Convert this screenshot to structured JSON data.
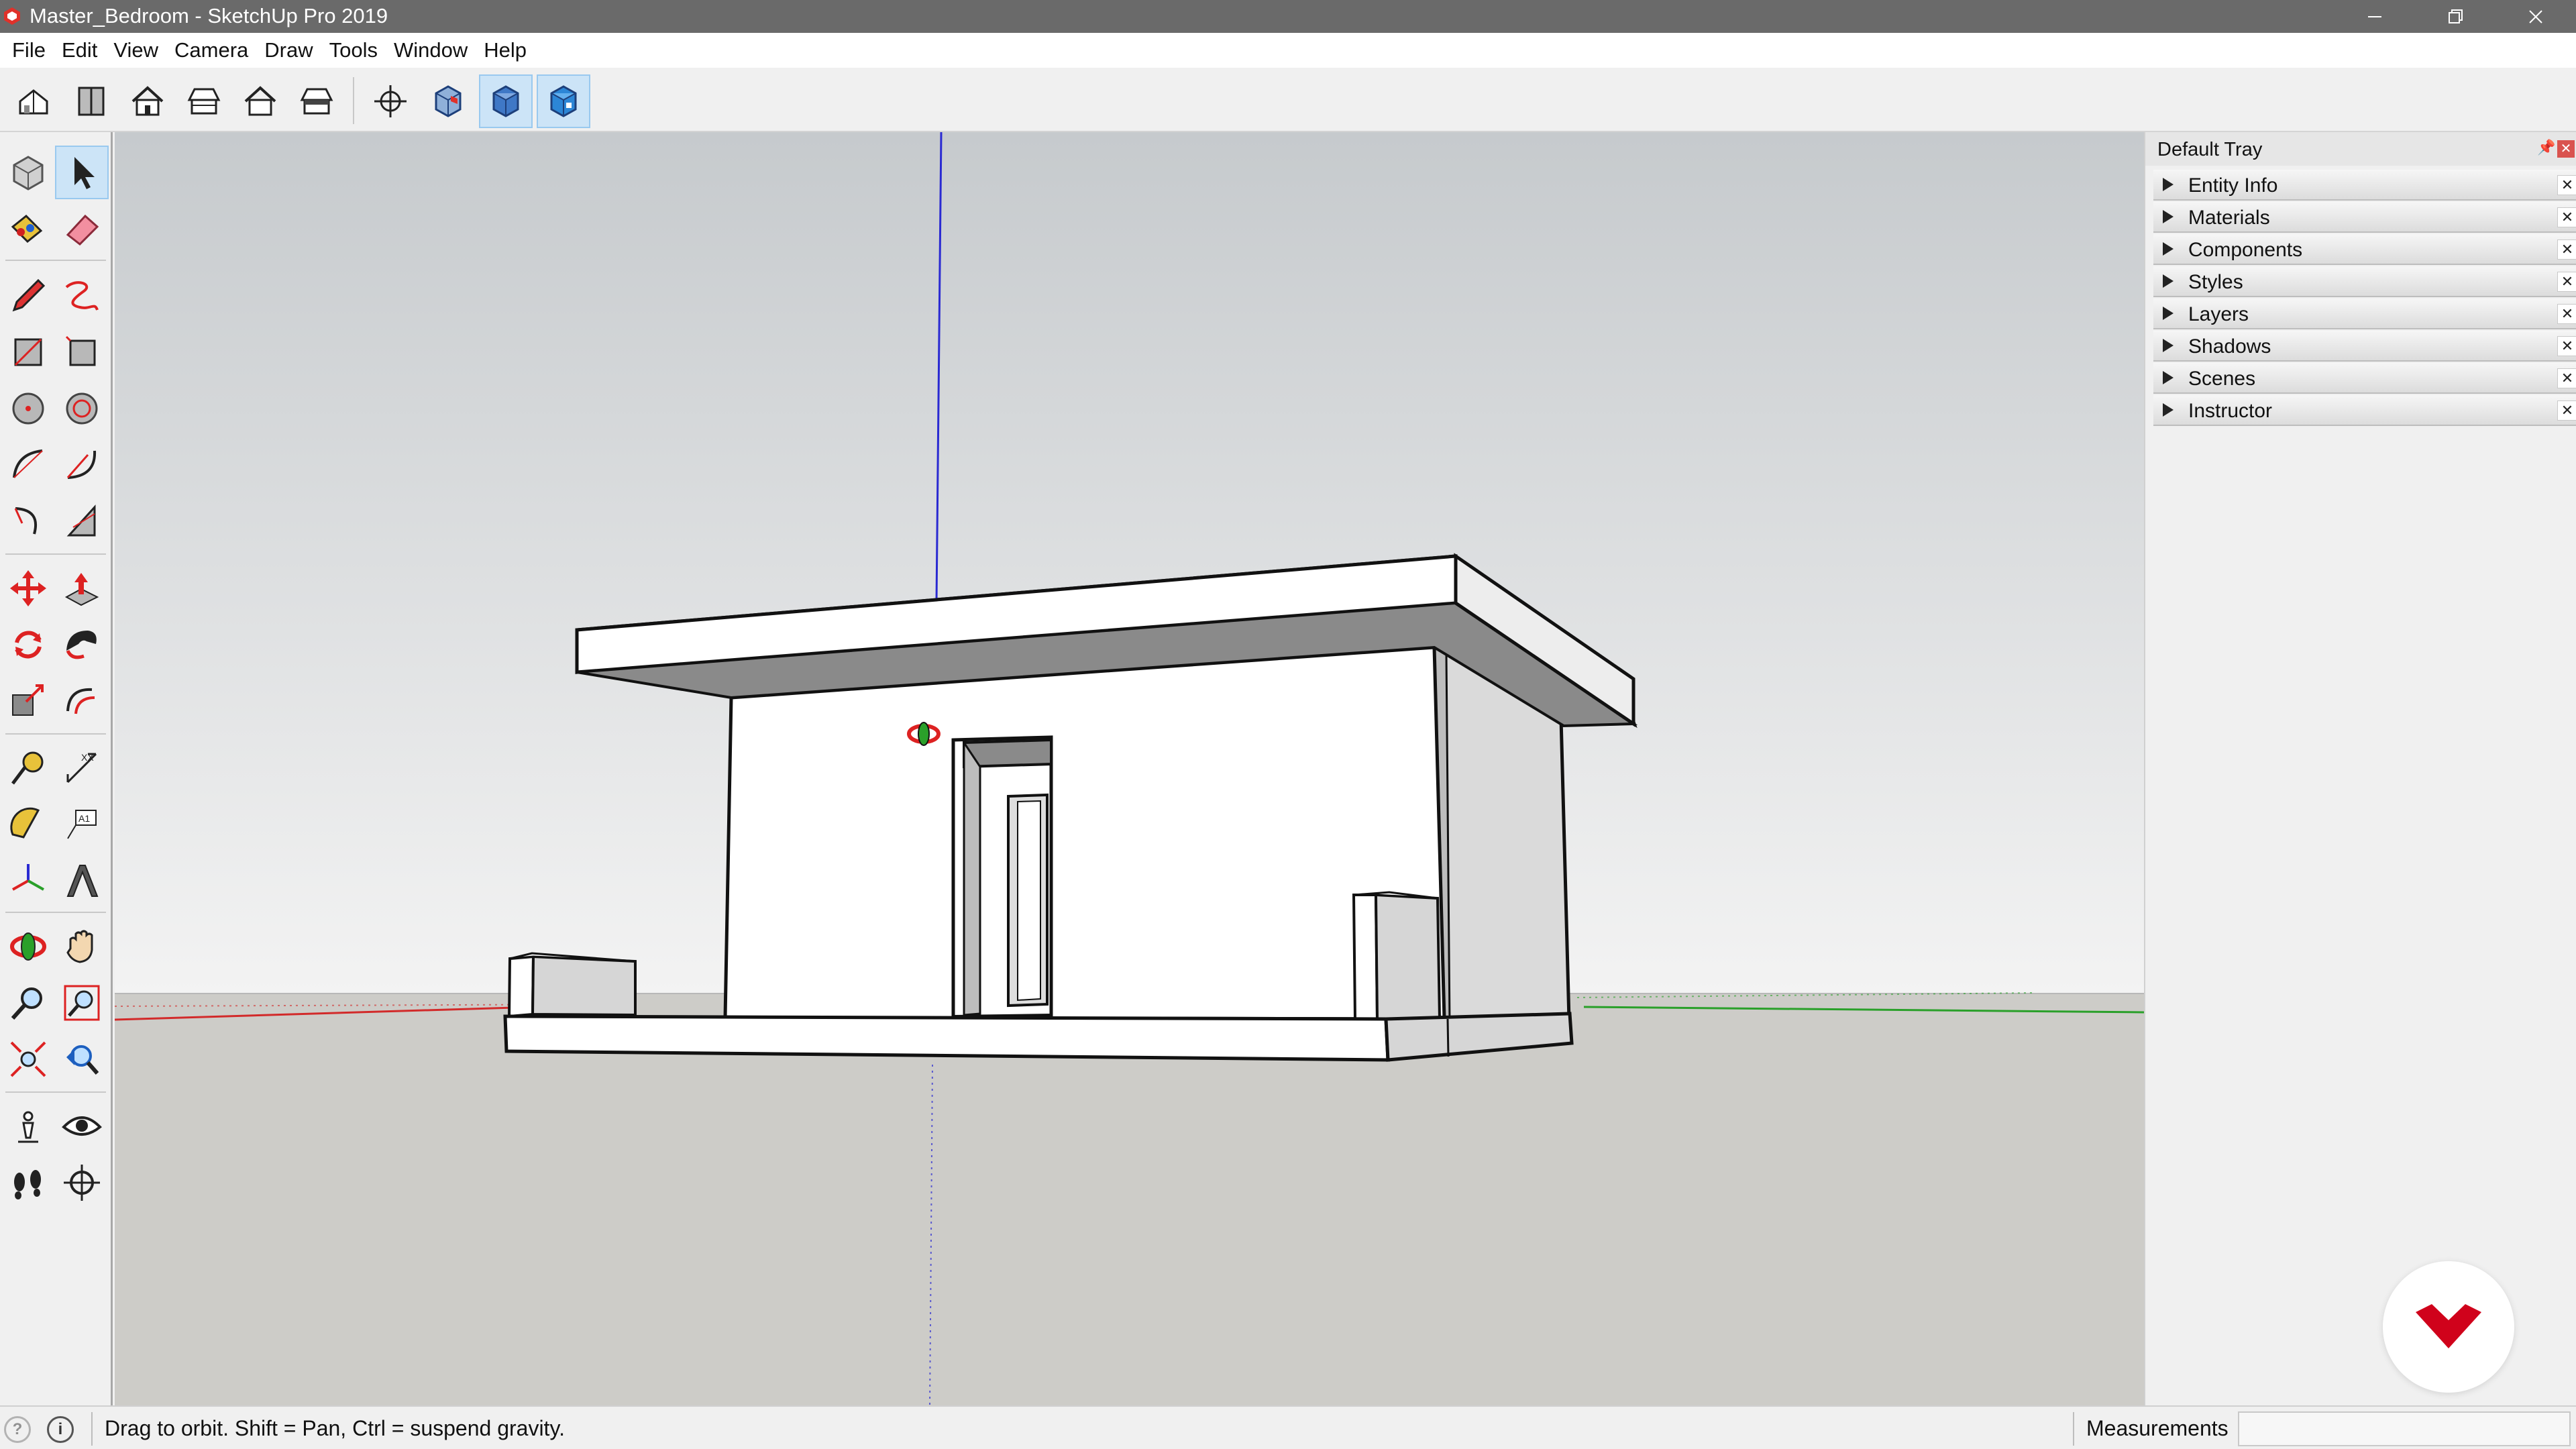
{
  "window": {
    "title": "Master_Bedroom - SketchUp Pro 2019",
    "app_icon": "sketchup-logo-icon",
    "controls": [
      "minimize-icon",
      "restore-icon",
      "close-icon"
    ]
  },
  "menu": [
    "File",
    "Edit",
    "View",
    "Camera",
    "Draw",
    "Tools",
    "Window",
    "Help"
  ],
  "toolbar": {
    "view_buttons": [
      {
        "name": "iso-view-button",
        "icon": "iso-house-icon"
      },
      {
        "name": "top-view-button",
        "icon": "top-view-icon"
      },
      {
        "name": "front-view-button",
        "icon": "front-house-icon"
      },
      {
        "name": "right-view-button",
        "icon": "right-house-icon"
      },
      {
        "name": "back-view-button",
        "icon": "back-house-icon"
      },
      {
        "name": "left-view-button",
        "icon": "left-house-icon"
      }
    ],
    "style_buttons": [
      {
        "name": "xray-button",
        "icon": "xray-icon",
        "active": false
      },
      {
        "name": "wireframe-button",
        "icon": "wireframe-box-icon",
        "active": false
      },
      {
        "name": "shaded-button",
        "icon": "shaded-box-icon",
        "active": true
      },
      {
        "name": "shaded-textures-button",
        "icon": "shaded-textures-box-icon",
        "active": true
      }
    ]
  },
  "palette_tools": [
    [
      "make-component",
      "select"
    ],
    [
      "paint-bucket",
      "eraser"
    ],
    [
      "line",
      "freehand"
    ],
    [
      "rectangle",
      "rotated-rectangle"
    ],
    [
      "circle",
      "polygon"
    ],
    [
      "arc",
      "2-point-arc"
    ],
    [
      "3-point-arc",
      "pie"
    ],
    [
      "move",
      "push-pull"
    ],
    [
      "rotate",
      "follow-me"
    ],
    [
      "scale",
      "offset"
    ],
    [
      "tape-measure",
      "dimension"
    ],
    [
      "protractor",
      "text"
    ],
    [
      "axes",
      "3d-text"
    ],
    [
      "orbit",
      "pan"
    ],
    [
      "zoom",
      "zoom-window"
    ],
    [
      "zoom-extents",
      "previous-view"
    ],
    [
      "position-camera",
      "look-around"
    ],
    [
      "walk",
      "section-plane"
    ]
  ],
  "palette_active": "select",
  "tray": {
    "title": "Default Tray",
    "panels": [
      "Entity Info",
      "Materials",
      "Components",
      "Styles",
      "Layers",
      "Shadows",
      "Scenes",
      "Instructor"
    ]
  },
  "status": {
    "hint": "Drag to orbit. Shift = Pan, Ctrl = suspend gravity.",
    "measurements_label": "Measurements",
    "measurements_value": ""
  },
  "colors": {
    "titlebar": "#6a6a6a",
    "sky_top": "#c6cacd",
    "sky_horizon": "#f3f3f3",
    "ground": "#cdccc8",
    "axis_red": "#d22a2a",
    "axis_green": "#2aa02a",
    "axis_blue": "#2a2ad2",
    "active_tool": "#cce4f7",
    "brand_red": "#d0021b"
  }
}
